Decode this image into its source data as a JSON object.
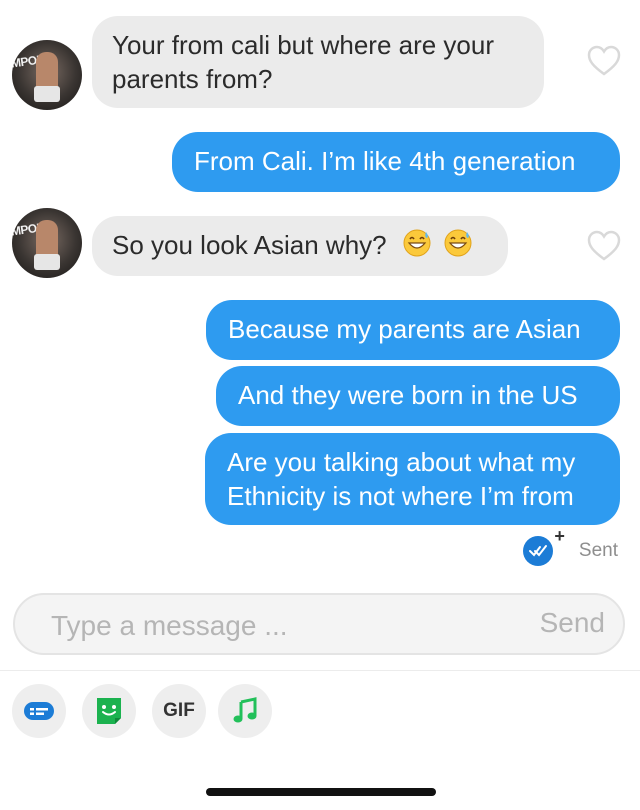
{
  "messages": [
    {
      "from": "them",
      "text_lines": [
        "Your from cali but where are your",
        "parents from?"
      ]
    },
    {
      "from": "me",
      "text": "From Cali. I’m like 4th generation"
    },
    {
      "from": "them",
      "text": "So you look Asian why?",
      "emojis": [
        "grinning-sweat-emoji",
        "grinning-sweat-emoji"
      ]
    },
    {
      "from": "me",
      "text": "Because my parents are Asian"
    },
    {
      "from": "me",
      "text": "And they were born in the US"
    },
    {
      "from": "me",
      "text_lines": [
        "Are you talking about what my",
        "Ethnicity is not where I’m from"
      ]
    }
  ],
  "avatar": {
    "text": "IMPORT"
  },
  "status": {
    "label": "Sent",
    "icon": "double-check-icon",
    "badge": "+"
  },
  "composer": {
    "placeholder": "Type a message ...",
    "send_label": "Send"
  },
  "toolbar": {
    "items": [
      {
        "icon": "sticker-card-icon"
      },
      {
        "icon": "smiley-sticker-icon"
      },
      {
        "label": "GIF"
      },
      {
        "icon": "music-note-icon"
      }
    ]
  },
  "colors": {
    "sent_bubble": "#2e9bf0",
    "received_bubble": "#ebebeb",
    "check_badge": "#1c7cd6",
    "music_icon": "#22c05a",
    "sticker_icon": "#1bb24f",
    "card_icon": "#1c7cd6"
  }
}
